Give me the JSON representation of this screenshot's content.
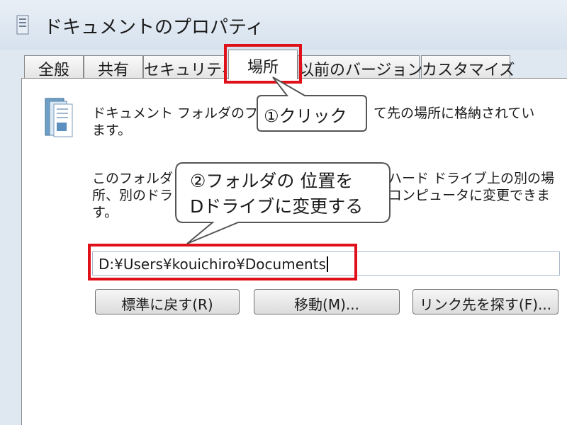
{
  "window": {
    "title": "ドキュメントのプロパティ"
  },
  "tabs": [
    {
      "label": "全般"
    },
    {
      "label": "共有"
    },
    {
      "label": "セキュリティ"
    },
    {
      "label": "場所"
    },
    {
      "label": "以前のバージョン"
    },
    {
      "label": "カスタマイズ"
    }
  ],
  "active_tab": "場所",
  "description": {
    "para1_line1_visible_left": "ドキュメント フォルダのファ",
    "para1_line1_visible_right": "て先の場所に格納されてい",
    "para1_line2": "ます。",
    "para2_line1_left": "このフォルダ",
    "para2_line1_right": "ハード ドライブ上の別の場",
    "para2_line2_left": "所、別のドラ",
    "para2_line2_right": "コンピュータに変更できま",
    "para2_line3": "す。"
  },
  "path": {
    "value": "D:¥Users¥kouichiro¥Documents"
  },
  "buttons": {
    "restore": "標準に戻す(R)",
    "move": "移動(M)...",
    "find_target": "リンク先を探す(F)..."
  },
  "annotations": {
    "callout1": "①クリック",
    "callout2_line1": "②フォルダの 位置を",
    "callout2_line2": "Dドライブに変更する"
  },
  "colors": {
    "highlight": "#e0101a",
    "window_bg": "#dfe8f1"
  }
}
